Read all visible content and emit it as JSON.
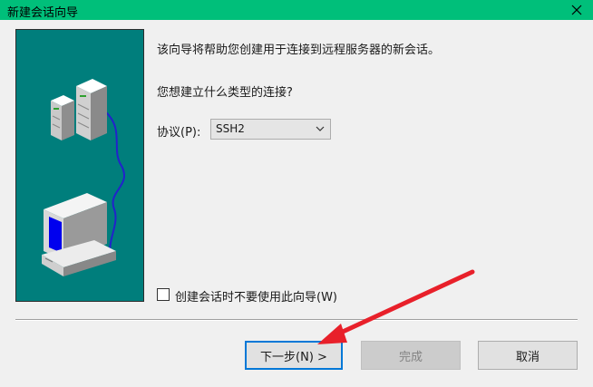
{
  "window": {
    "title": "新建会话向导"
  },
  "wizard": {
    "intro": "该向导将帮助您创建用于连接到远程服务器的新会话。",
    "question": "您想建立什么类型的连接?",
    "protocol_label": "协议(P):",
    "protocol_value": "SSH2",
    "checkbox_label": "创建会话时不要使用此向导(W)",
    "checkbox_checked": false
  },
  "buttons": {
    "next": "下一步(N) >",
    "finish": "完成",
    "cancel": "取消"
  },
  "colors": {
    "titlebar": "#00bf7a",
    "panel": "#007e7c",
    "annotation_arrow": "#e8202a"
  },
  "icons": {
    "close": "close-icon",
    "dropdown": "chevron-down-icon",
    "illustration": "servers-and-computer-illustration"
  }
}
